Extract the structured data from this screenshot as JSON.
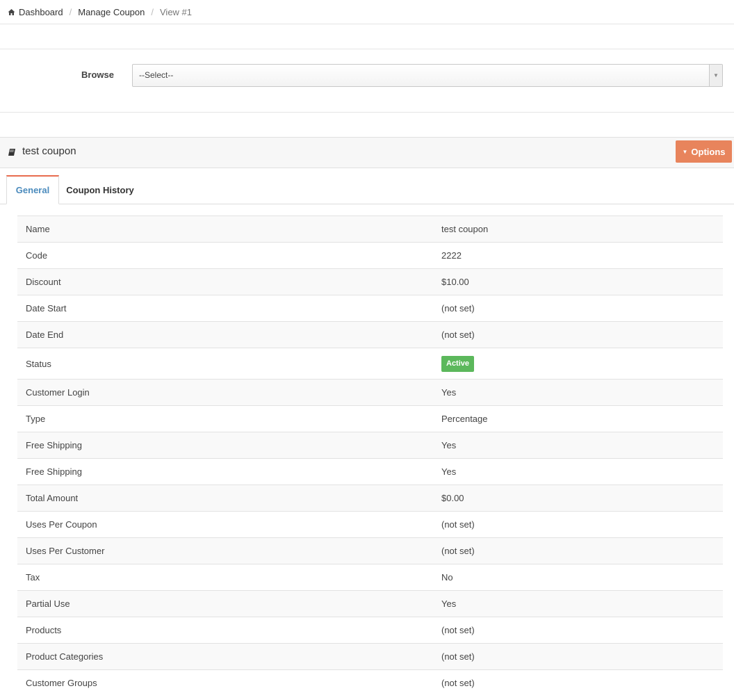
{
  "breadcrumb": {
    "home": "Dashboard",
    "section": "Manage Coupon",
    "current": "View #1"
  },
  "browse": {
    "label": "Browse",
    "selected": "--Select--"
  },
  "panel": {
    "title": "test coupon",
    "options_label": "Options"
  },
  "tabs": [
    {
      "label": "General",
      "active": true
    },
    {
      "label": "Coupon History",
      "active": false
    }
  ],
  "details": [
    {
      "label": "Name",
      "value": "test coupon"
    },
    {
      "label": "Code",
      "value": "2222"
    },
    {
      "label": "Discount",
      "value": "$10.00"
    },
    {
      "label": "Date Start",
      "value": "(not set)"
    },
    {
      "label": "Date End",
      "value": "(not set)"
    },
    {
      "label": "Status",
      "value": "Active"
    },
    {
      "label": "Customer Login",
      "value": "Yes"
    },
    {
      "label": "Type",
      "value": "Percentage"
    },
    {
      "label": "Free Shipping",
      "value": "Yes"
    },
    {
      "label": "Free Shipping",
      "value": "Yes"
    },
    {
      "label": "Total Amount",
      "value": "$0.00"
    },
    {
      "label": "Uses Per Coupon",
      "value": "(not set)"
    },
    {
      "label": "Uses Per Customer",
      "value": "(not set)"
    },
    {
      "label": "Tax",
      "value": "No"
    },
    {
      "label": "Partial Use",
      "value": "Yes"
    },
    {
      "label": "Products",
      "value": "(not set)"
    },
    {
      "label": "Product Categories",
      "value": "(not set)"
    },
    {
      "label": "Customer Groups",
      "value": "(not set)"
    }
  ],
  "colors": {
    "accent": "#e8845c",
    "tab_active": "#4b8bbd",
    "status_active": "#5cb85c"
  },
  "icons": {
    "breadcrumb_home": "home-icon",
    "panel_title": "book-icon",
    "options_caret": "caret-down-icon",
    "select_arrow": "chevron-down-icon"
  }
}
